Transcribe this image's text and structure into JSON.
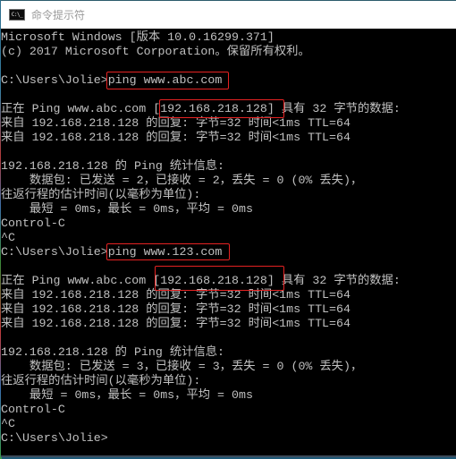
{
  "window": {
    "title": "命令提示符",
    "icon": "cmd-icon",
    "icon_text": "C:\\_"
  },
  "console": {
    "lines": [
      "Microsoft Windows [版本 10.0.16299.371]",
      "(c) 2017 Microsoft Corporation。保留所有权利。",
      "",
      "C:\\Users\\Jolie>ping www.abc.com",
      "",
      "正在 Ping www.abc.com [192.168.218.128] 具有 32 字节的数据:",
      "来自 192.168.218.128 的回复: 字节=32 时间<1ms TTL=64",
      "来自 192.168.218.128 的回复: 字节=32 时间<1ms TTL=64",
      "",
      "192.168.218.128 的 Ping 统计信息:",
      "    数据包: 已发送 = 2，已接收 = 2，丢失 = 0 (0% 丢失)，",
      "往返行程的估计时间(以毫秒为单位):",
      "    最短 = 0ms，最长 = 0ms，平均 = 0ms",
      "Control-C",
      "^C",
      "C:\\Users\\Jolie>ping www.123.com",
      "",
      "正在 Ping www.abc.com [192.168.218.128] 具有 32 字节的数据:",
      "来自 192.168.218.128 的回复: 字节=32 时间<1ms TTL=64",
      "来自 192.168.218.128 的回复: 字节=32 时间<1ms TTL=64",
      "来自 192.168.218.128 的回复: 字节=32 时间<1ms TTL=64",
      "",
      "192.168.218.128 的 Ping 统计信息:",
      "    数据包: 已发送 = 3，已接收 = 3，丢失 = 0 (0% 丢失)，",
      "往返行程的估计时间(以毫秒为单位):",
      "    最短 = 0ms，最长 = 0ms，平均 = 0ms",
      "Control-C",
      "^C",
      "C:\\Users\\Jolie>"
    ],
    "highlights": [
      {
        "label": "command-ping-abc",
        "text": "ping www.abc.com"
      },
      {
        "label": "resolved-ip-1",
        "text": "[192.168.218.128]"
      },
      {
        "label": "command-ping-123",
        "text": "ping www.123.com"
      },
      {
        "label": "resolved-ip-2",
        "text": "[192.168.218.128]"
      }
    ],
    "highlight_color": "#e52222",
    "text_color": "#c0c0c0",
    "background_color": "#000000"
  }
}
